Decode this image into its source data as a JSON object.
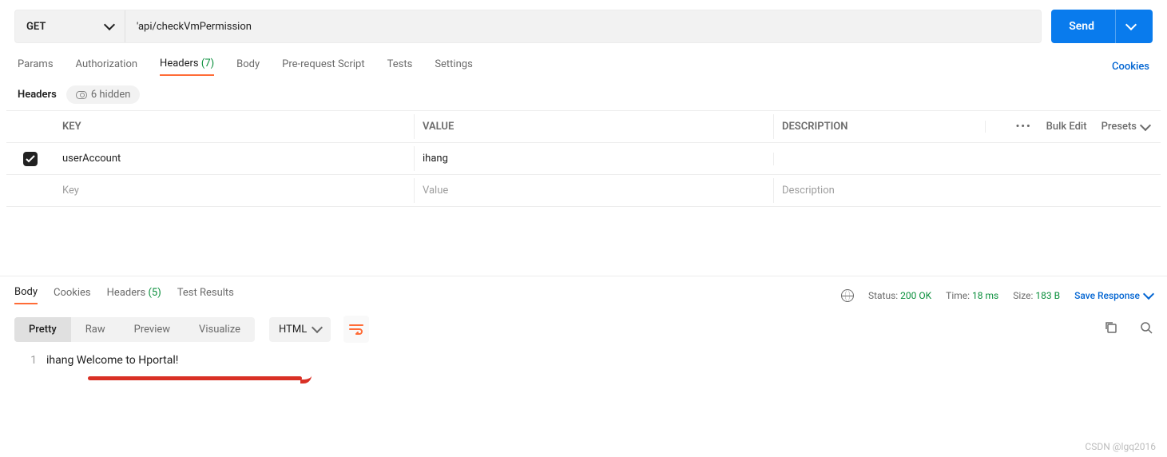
{
  "request": {
    "method": "GET",
    "url": "'api/checkVmPermission",
    "send_label": "Send"
  },
  "req_tabs": {
    "params": "Params",
    "auth": "Authorization",
    "headers": "Headers",
    "headers_count": "(7)",
    "body": "Body",
    "prerequest": "Pre-request Script",
    "tests": "Tests",
    "settings": "Settings",
    "cookies_link": "Cookies"
  },
  "headers_sub": {
    "label": "Headers",
    "hidden": "6 hidden"
  },
  "htable": {
    "key_h": "KEY",
    "val_h": "VALUE",
    "desc_h": "DESCRIPTION",
    "bulk": "Bulk Edit",
    "presets": "Presets",
    "rows": [
      {
        "checked": true,
        "key": "userAccount",
        "value": "ihang",
        "description": ""
      }
    ],
    "placeholders": {
      "key": "Key",
      "value": "Value",
      "description": "Description"
    }
  },
  "resp_tabs": {
    "body": "Body",
    "cookies": "Cookies",
    "headers": "Headers",
    "headers_count": "(5)",
    "test_results": "Test Results"
  },
  "resp_meta": {
    "status_label": "Status:",
    "status_value": "200 OK",
    "time_label": "Time:",
    "time_value": "18 ms",
    "size_label": "Size:",
    "size_value": "183 B",
    "save": "Save Response"
  },
  "body_toolbar": {
    "pretty": "Pretty",
    "raw": "Raw",
    "preview": "Preview",
    "visualize": "Visualize",
    "format": "HTML"
  },
  "body_content": {
    "line_no": "1",
    "text": "ihang Welcome to Hportal!"
  },
  "watermark": "CSDN @lgq2016"
}
